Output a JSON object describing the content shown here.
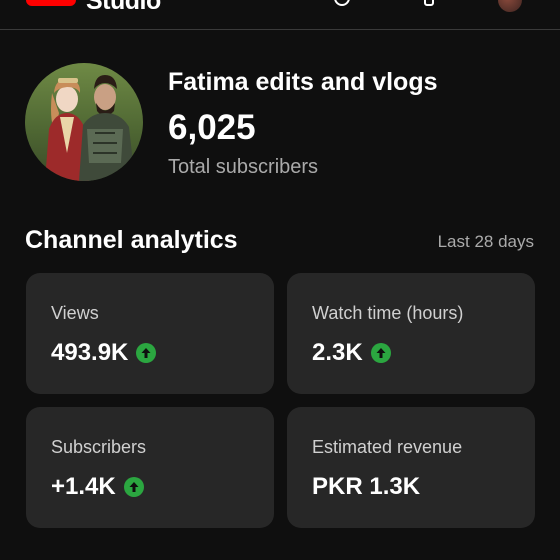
{
  "app": {
    "name": "Studio",
    "logo_icon": "youtube-logo-icon",
    "colors": {
      "brand": "#ff0000",
      "trend_up": "#2ba640",
      "card_bg": "#272727",
      "page_bg": "#0f0f0f"
    }
  },
  "channel": {
    "name": "Fatima edits and vlogs",
    "subscriber_count": "6,025",
    "subscriber_label": "Total subscribers"
  },
  "analytics": {
    "title": "Channel analytics",
    "period": "Last 28 days",
    "cards": [
      {
        "label": "Views",
        "value": "493.9K",
        "trend": "up",
        "trend_icon": "arrow-up-circle-icon"
      },
      {
        "label": "Watch time (hours)",
        "value": "2.3K",
        "trend": "up",
        "trend_icon": "arrow-up-circle-icon"
      },
      {
        "label": "Subscribers",
        "value": "+1.4K",
        "trend": "up",
        "trend_icon": "arrow-up-circle-icon"
      },
      {
        "label": "Estimated revenue",
        "value": "PKR 1.3K",
        "trend": "none"
      }
    ]
  }
}
